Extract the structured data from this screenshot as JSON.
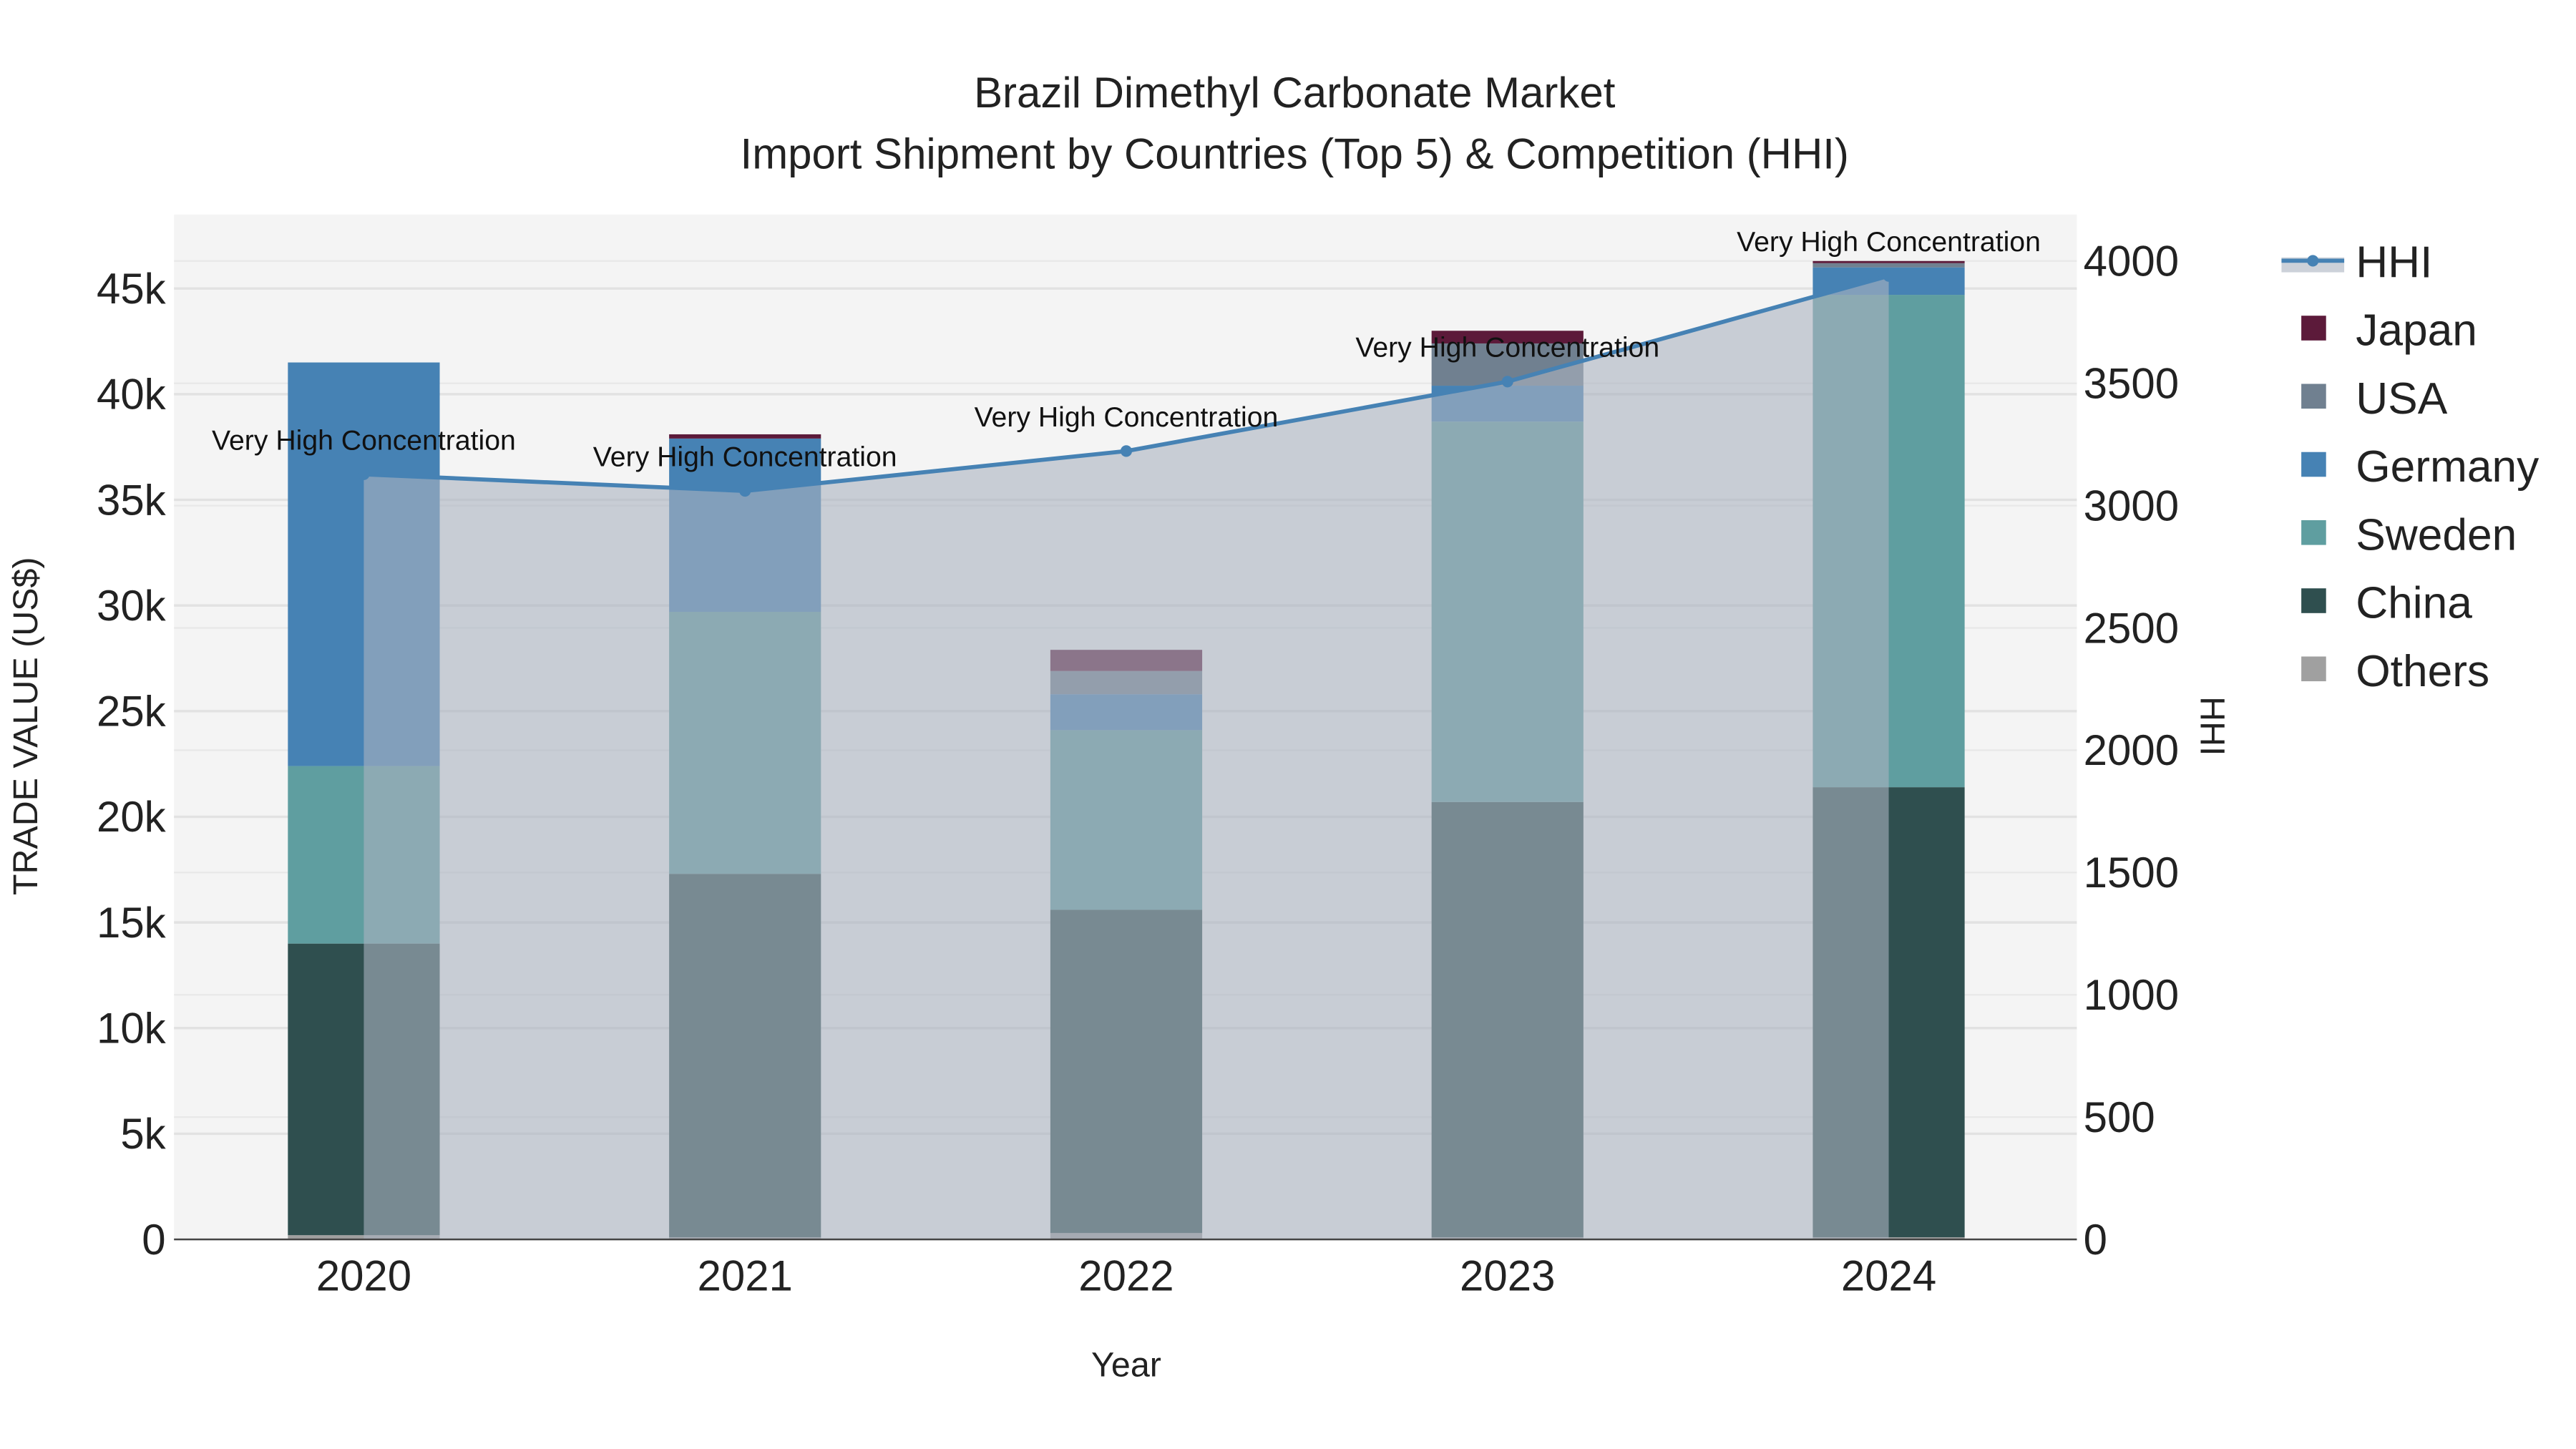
{
  "chart_data": {
    "type": "bar",
    "stacked": true,
    "title_line1": "Brazil Dimethyl Carbonate Market",
    "title_line2": "Import Shipment by Countries (Top 5) & Competition (HHI)",
    "xlabel": "Year",
    "ylabel": "TRADE VALUE (US$)",
    "y2label": "HHI",
    "categories": [
      "2020",
      "2021",
      "2022",
      "2023",
      "2024"
    ],
    "ylim": [
      0,
      48500
    ],
    "y2lim": [
      0,
      4190
    ],
    "yticks": [
      0,
      5000,
      10000,
      15000,
      20000,
      25000,
      30000,
      35000,
      40000,
      45000
    ],
    "ytick_labels": [
      "0",
      "5k",
      "10k",
      "15k",
      "20k",
      "25k",
      "30k",
      "35k",
      "40k",
      "45k"
    ],
    "y2ticks": [
      0,
      500,
      1000,
      1500,
      2000,
      2500,
      3000,
      3500,
      4000
    ],
    "y2tick_labels": [
      "0",
      "500",
      "1000",
      "1500",
      "2000",
      "2500",
      "3000",
      "3500",
      "4000"
    ],
    "series": [
      {
        "name": "Others",
        "color": "#a0a0a0",
        "values": [
          200,
          100,
          300,
          100,
          100
        ]
      },
      {
        "name": "China",
        "color": "#2f4f4f",
        "values": [
          13800,
          17200,
          15300,
          20600,
          21300
        ]
      },
      {
        "name": "Sweden",
        "color": "#5f9ea0",
        "values": [
          8400,
          12400,
          8500,
          18000,
          23300
        ]
      },
      {
        "name": "Germany",
        "color": "#4682b4",
        "values": [
          19100,
          8200,
          1700,
          1700,
          1300
        ]
      },
      {
        "name": "USA",
        "color": "#708090",
        "values": [
          0,
          0,
          1100,
          2000,
          200
        ]
      },
      {
        "name": "Japan",
        "color": "#5c1a3a",
        "values": [
          0,
          200,
          1000,
          600,
          100
        ]
      }
    ],
    "hhi": {
      "name": "HHI",
      "color": "#4682b4",
      "values": [
        3128,
        3060,
        3223,
        3507,
        3939
      ]
    },
    "annotations": [
      "Very High Concentration",
      "Very High Concentration",
      "Very High Concentration",
      "Very High Concentration",
      "Very High Concentration"
    ],
    "legend_order": [
      "HHI",
      "Japan",
      "USA",
      "Germany",
      "Sweden",
      "China",
      "Others"
    ],
    "legend_position": "right",
    "grid": true
  }
}
